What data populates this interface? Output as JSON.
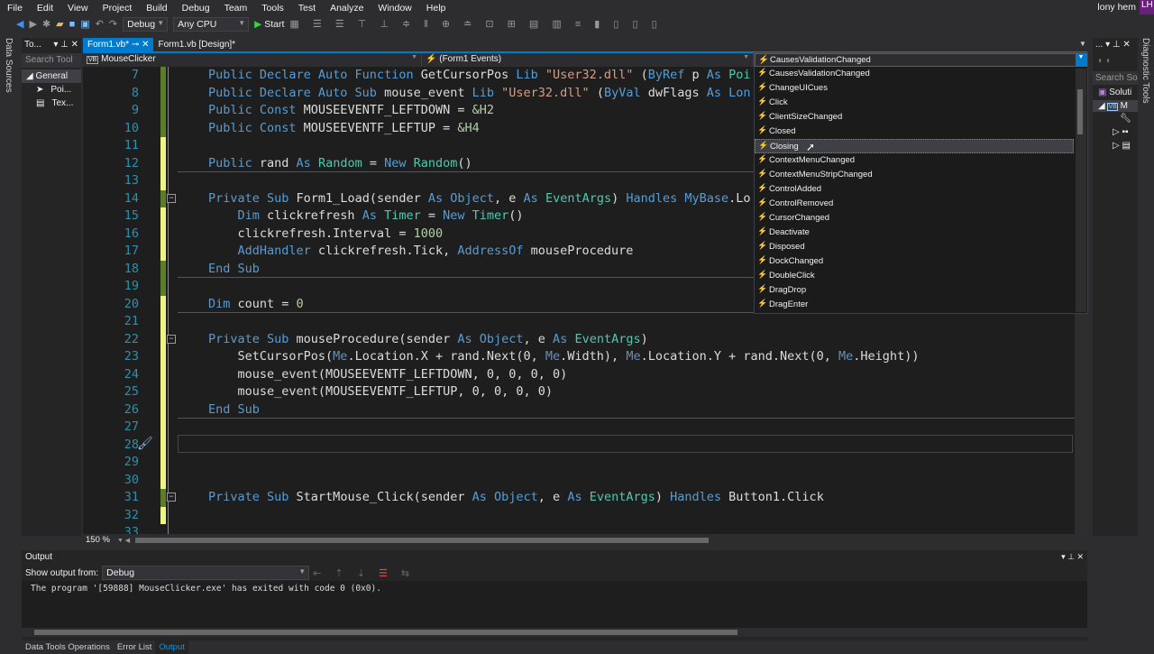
{
  "menu": [
    "File",
    "Edit",
    "View",
    "Project",
    "Build",
    "Debug",
    "Team",
    "Tools",
    "Test",
    "Analyze",
    "Window",
    "Help"
  ],
  "user": {
    "name": "lony hem",
    "initials": "LH"
  },
  "toolbar": {
    "config": "Debug",
    "platform": "Any CPU",
    "start": "Start"
  },
  "left_strip": "Data Sources",
  "toolbox": {
    "title": "To...",
    "search": "Search Tool",
    "group": "General",
    "items": [
      "Poi...",
      "Tex..."
    ]
  },
  "tabs": [
    {
      "label": "Form1.vb*",
      "active": true
    },
    {
      "label": "Form1.vb [Design]*",
      "active": false
    }
  ],
  "navbar": {
    "project": "MouseClicker",
    "object": "(Form1 Events)"
  },
  "event_dropdown": {
    "selected": "CausesValidationChanged",
    "highlighted": "Closing",
    "items": [
      "CausesValidationChanged",
      "ChangeUICues",
      "Click",
      "ClientSizeChanged",
      "Closed",
      "Closing",
      "ContextMenuChanged",
      "ContextMenuStripChanged",
      "ControlAdded",
      "ControlRemoved",
      "CursorChanged",
      "Deactivate",
      "Disposed",
      "DockChanged",
      "DoubleClick",
      "DragDrop",
      "DragEnter"
    ]
  },
  "code": [
    {
      "n": "7",
      "t": [
        [
          "Public Declare Auto Function ",
          "kw"
        ],
        [
          "GetCursorPos ",
          "id"
        ],
        [
          "Lib ",
          "kw"
        ],
        [
          "\"User32.dll\" ",
          "str"
        ],
        [
          "(",
          "id"
        ],
        [
          "ByRef ",
          "kw"
        ],
        [
          "p ",
          "id"
        ],
        [
          "As ",
          "kw"
        ],
        [
          "Poi",
          "ty"
        ]
      ]
    },
    {
      "n": "8",
      "t": [
        [
          "Public Declare Auto Sub ",
          "kw"
        ],
        [
          "mouse_event ",
          "id"
        ],
        [
          "Lib ",
          "kw"
        ],
        [
          "\"User32.dll\" ",
          "str"
        ],
        [
          "(",
          "id"
        ],
        [
          "ByVal ",
          "kw"
        ],
        [
          "dwFlags ",
          "id"
        ],
        [
          "As ",
          "kw"
        ],
        [
          "Lon",
          "kw"
        ]
      ]
    },
    {
      "n": "9",
      "t": [
        [
          "Public Const ",
          "kw"
        ],
        [
          "MOUSEEVENTF_LEFTDOWN = ",
          "id"
        ],
        [
          "&H2",
          "num"
        ]
      ]
    },
    {
      "n": "10",
      "t": [
        [
          "Public Const ",
          "kw"
        ],
        [
          "MOUSEEVENTF_LEFTUP = ",
          "id"
        ],
        [
          "&H4",
          "num"
        ]
      ]
    },
    {
      "n": "11",
      "t": []
    },
    {
      "n": "12",
      "t": [
        [
          "Public ",
          "kw"
        ],
        [
          "rand ",
          "id"
        ],
        [
          "As ",
          "kw"
        ],
        [
          "Random ",
          "ty"
        ],
        [
          "= ",
          "id"
        ],
        [
          "New ",
          "kw"
        ],
        [
          "Random",
          "ty"
        ],
        [
          "()",
          "id"
        ]
      ]
    },
    {
      "n": "13",
      "t": []
    },
    {
      "n": "14",
      "t": [
        [
          "Private Sub ",
          "kw"
        ],
        [
          "Form1_Load(sender ",
          "id"
        ],
        [
          "As ",
          "kw"
        ],
        [
          "Object",
          "kw"
        ],
        [
          ", e ",
          "id"
        ],
        [
          "As ",
          "kw"
        ],
        [
          "EventArgs",
          "ty"
        ],
        [
          ") ",
          "id"
        ],
        [
          "Handles ",
          "kw"
        ],
        [
          "MyBase",
          "kw"
        ],
        [
          ".Lo",
          "id"
        ]
      ]
    },
    {
      "n": "15",
      "t": [
        [
          "    Dim ",
          "kw"
        ],
        [
          "clickrefresh ",
          "id"
        ],
        [
          "As ",
          "kw"
        ],
        [
          "Timer ",
          "ty"
        ],
        [
          "= ",
          "id"
        ],
        [
          "New ",
          "kw"
        ],
        [
          "Timer",
          "ty"
        ],
        [
          "()",
          "id"
        ]
      ]
    },
    {
      "n": "16",
      "t": [
        [
          "    clickrefresh.Interval = ",
          "id"
        ],
        [
          "1000",
          "num"
        ]
      ]
    },
    {
      "n": "17",
      "t": [
        [
          "    AddHandler ",
          "kw"
        ],
        [
          "clickrefresh.Tick, ",
          "id"
        ],
        [
          "AddressOf ",
          "kw"
        ],
        [
          "mouseProcedure",
          "id"
        ]
      ]
    },
    {
      "n": "18",
      "t": [
        [
          "End Sub",
          "kw"
        ]
      ]
    },
    {
      "n": "19",
      "t": []
    },
    {
      "n": "20",
      "t": [
        [
          "Dim ",
          "kw"
        ],
        [
          "count = ",
          "id"
        ],
        [
          "0",
          "num"
        ]
      ]
    },
    {
      "n": "21",
      "t": []
    },
    {
      "n": "22",
      "t": [
        [
          "Private Sub ",
          "kw"
        ],
        [
          "mouseProcedure(sender ",
          "id"
        ],
        [
          "As ",
          "kw"
        ],
        [
          "Object",
          "kw"
        ],
        [
          ", e ",
          "id"
        ],
        [
          "As ",
          "kw"
        ],
        [
          "EventArgs",
          "ty"
        ],
        [
          ")",
          "id"
        ]
      ]
    },
    {
      "n": "23",
      "t": [
        [
          "    SetCursorPos(",
          "id"
        ],
        [
          "Me",
          "me"
        ],
        [
          ".Location.X + rand.Next(0, ",
          "id"
        ],
        [
          "Me",
          "me"
        ],
        [
          ".Width), ",
          "id"
        ],
        [
          "Me",
          "me"
        ],
        [
          ".Location.Y + rand.Next(0, ",
          "id"
        ],
        [
          "Me",
          "me"
        ],
        [
          ".Height))",
          "id"
        ]
      ]
    },
    {
      "n": "24",
      "t": [
        [
          "    mouse_event(MOUSEEVENTF_LEFTDOWN, 0, 0, 0, 0)",
          "id"
        ]
      ]
    },
    {
      "n": "25",
      "t": [
        [
          "    mouse_event(MOUSEEVENTF_LEFTUP, 0, 0, 0, 0)",
          "id"
        ]
      ]
    },
    {
      "n": "26",
      "t": [
        [
          "End Sub",
          "kw"
        ]
      ]
    },
    {
      "n": "27",
      "t": []
    },
    {
      "n": "28",
      "t": []
    },
    {
      "n": "29",
      "t": []
    },
    {
      "n": "30",
      "t": []
    },
    {
      "n": "31",
      "t": [
        [
          "Private Sub ",
          "kw"
        ],
        [
          "StartMouse_Click(sender ",
          "id"
        ],
        [
          "As ",
          "kw"
        ],
        [
          "Object",
          "kw"
        ],
        [
          ", e ",
          "id"
        ],
        [
          "As ",
          "kw"
        ],
        [
          "EventArgs",
          "ty"
        ],
        [
          ") ",
          "id"
        ],
        [
          "Handles ",
          "kw"
        ],
        [
          "Button1.Click",
          "id"
        ]
      ]
    },
    {
      "n": "32",
      "t": []
    },
    {
      "n": "33",
      "t": []
    }
  ],
  "change_marks": {
    "saved": [
      "7",
      "8",
      "9",
      "10",
      "14",
      "18",
      "19"
    ],
    "color_saved": "#5c7e2a",
    "color_unsaved": "#eff584"
  },
  "zoom": "150 %",
  "solution": {
    "search": "Search Solu",
    "root": "Soluti",
    "project": "M"
  },
  "right_strip": "Diagnostic Tools",
  "output": {
    "title": "Output",
    "show_from_label": "Show output from:",
    "source": "Debug",
    "text": "The program '[59888] MouseClicker.exe' has exited with code 0 (0x0)."
  },
  "bottom_tabs": [
    {
      "label": "Data Tools Operations",
      "active": false
    },
    {
      "label": "Error List",
      "active": false
    },
    {
      "label": "Output",
      "active": true
    }
  ]
}
